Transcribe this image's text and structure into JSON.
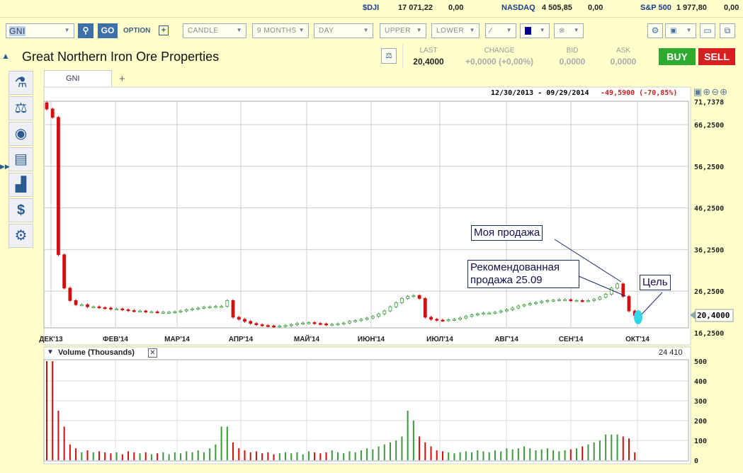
{
  "ticker": [
    {
      "name": "$DJI",
      "value": "17 071,22",
      "change": "0,00"
    },
    {
      "name": "NASDAQ",
      "value": "4 505,85",
      "change": "0,00"
    },
    {
      "name": "S&P 500",
      "value": "1 977,80",
      "change": "0,00"
    }
  ],
  "toolbar": {
    "symbol": "GNI",
    "go": "GO",
    "option": "OPTION",
    "chart_type": "CANDLE",
    "period": "9 MONTHS",
    "interval": "DAY",
    "upper": "UPPER",
    "lower": "LOWER"
  },
  "quote": {
    "title": "Great Northern Iron Ore Properties",
    "last_label": "LAST",
    "last": "20,4000",
    "change_label": "CHANGE",
    "change": "+0,0000 (+0,00%)",
    "bid_label": "BID",
    "bid": "0,0000",
    "ask_label": "ASK",
    "ask": "0,0000",
    "buy": "BUY",
    "sell": "SELL"
  },
  "tab": {
    "name": "GNI",
    "add": "+"
  },
  "chart_data": {
    "type": "candlestick",
    "range_text": "12/30/2013 - 09/29/2014",
    "range_change": "-49,5900 (-70,85%)",
    "y_ticks": [
      "71,7378",
      "66,2500",
      "56,2500",
      "46,2500",
      "36,2500",
      "26,2500",
      "16,2500"
    ],
    "y_tick_values": [
      71.7378,
      66.25,
      56.25,
      46.25,
      36.25,
      26.25,
      16.25
    ],
    "ylim": [
      16.25,
      71.7378
    ],
    "current_price": "20,4000",
    "x_labels": [
      "ДЕК'13",
      "ФЕВ'14",
      "МАР'14",
      "АПР'14",
      "МАЙ'14",
      "ИЮН'14",
      "ИЮЛ'14",
      "АВГ'14",
      "СЕН'14",
      "ОКТ'14"
    ],
    "close": [
      70,
      68,
      35,
      27,
      24,
      23,
      23,
      22.5,
      22.5,
      22.3,
      22.2,
      22,
      22,
      21.8,
      21.6,
      21.5,
      21.5,
      21.3,
      21.3,
      21.2,
      21.2,
      21.2,
      21.3,
      21.5,
      21.8,
      22,
      22.2,
      22.4,
      22.5,
      22.6,
      22.6,
      24,
      20,
      19.5,
      19,
      18.5,
      18.2,
      18,
      17.9,
      17.8,
      17.9,
      18,
      18.2,
      18.5,
      18.6,
      18.7,
      18.5,
      18.4,
      18.2,
      18.3,
      18.4,
      18.6,
      19,
      19.2,
      19.5,
      19.8,
      20.2,
      20.8,
      21.5,
      22.5,
      23.5,
      24.5,
      25,
      25.2,
      24.5,
      20,
      19.5,
      19.3,
      19.2,
      19.4,
      19.5,
      19.8,
      20.2,
      20.6,
      20.8,
      21,
      21,
      21.2,
      21.5,
      21.8,
      22.2,
      22.7,
      23,
      23.3,
      23.5,
      23.8,
      24,
      24.1,
      24.2,
      24.2,
      24,
      24,
      23.9,
      24,
      24.3,
      24.8,
      25.5,
      27,
      28,
      25,
      21.5,
      20.4
    ],
    "volume_title": "Volume (Thousands)",
    "volume_last": "24 410",
    "volume_ticks": [
      "500",
      "400",
      "300",
      "200",
      "100",
      "0"
    ],
    "volume": [
      500,
      500,
      250,
      170,
      80,
      60,
      40,
      50,
      40,
      45,
      40,
      35,
      40,
      30,
      45,
      40,
      35,
      40,
      30,
      35,
      40,
      30,
      40,
      35,
      45,
      40,
      50,
      40,
      60,
      80,
      170,
      170,
      90,
      60,
      50,
      40,
      45,
      35,
      40,
      30,
      35,
      40,
      35,
      40,
      30,
      45,
      40,
      35,
      40,
      50,
      40,
      35,
      45,
      40,
      50,
      60,
      55,
      70,
      80,
      90,
      100,
      120,
      250,
      200,
      120,
      90,
      70,
      50,
      45,
      40,
      35,
      40,
      45,
      40,
      50,
      45,
      40,
      50,
      45,
      60,
      55,
      60,
      70,
      60,
      50,
      55,
      60,
      50,
      45,
      50,
      55,
      60,
      70,
      80,
      90,
      100,
      130,
      130,
      130,
      120,
      110,
      40
    ],
    "annotations": [
      "Моя продажа",
      "Рекомендованная продажа 25.09",
      "Цель"
    ]
  }
}
